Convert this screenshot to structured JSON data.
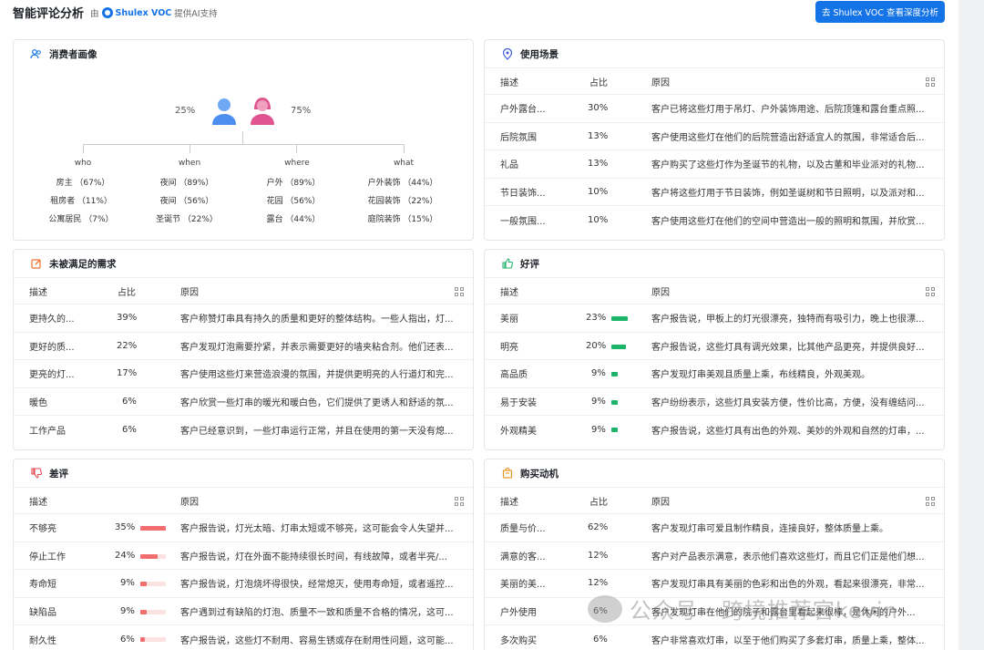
{
  "header": {
    "title": "智能评论分析",
    "by_prefix": "由",
    "brand": "Shulex VOC",
    "by_suffix": "提供AI支持",
    "cta": "去 Shulex VOC 查看深度分析"
  },
  "common": {
    "col_desc": "描述",
    "col_pct": "占比",
    "col_reason": "原因"
  },
  "persona": {
    "title": "消费者画像",
    "male_pct": "25%",
    "female_pct": "75%",
    "columns": [
      {
        "head": "who",
        "items": [
          "房主 （67%）",
          "租房者 （11%）",
          "公寓居民 （7%）"
        ]
      },
      {
        "head": "when",
        "items": [
          "夜间 （89%）",
          "夜间 （56%）",
          "圣诞节 （22%）"
        ]
      },
      {
        "head": "where",
        "items": [
          "户外 （89%）",
          "花园 （56%）",
          "露台 （44%）"
        ]
      },
      {
        "head": "what",
        "items": [
          "户外装饰 （44%）",
          "花园装饰 （22%）",
          "庭院装饰 （15%）"
        ]
      }
    ]
  },
  "scenes": {
    "title": "使用场景",
    "rows": [
      {
        "desc": "户外露台...",
        "pct": "30%",
        "reason": "客户已将这些灯用于吊灯、户外装饰用途、后院顶篷和露台重点照..."
      },
      {
        "desc": "后院氛围",
        "pct": "13%",
        "reason": "客户使用这些灯在他们的后院营造出舒适宜人的氛围，非常适合后..."
      },
      {
        "desc": "礼品",
        "pct": "13%",
        "reason": "客户购买了这些灯作为圣诞节的礼物，以及古董和毕业派对的礼物..."
      },
      {
        "desc": "节日装饰...",
        "pct": "10%",
        "reason": "客户将这些灯用于节日装饰，例如圣诞树和节日照明，以及派对和..."
      },
      {
        "desc": "一般氛围...",
        "pct": "10%",
        "reason": "客户使用这些灯在他们的空间中营造出一般的照明和氛围，并欣赏..."
      }
    ]
  },
  "unmet": {
    "title": "未被满足的需求",
    "rows": [
      {
        "desc": "更持久的...",
        "pct": "39%",
        "reason": "客户称赞灯串具有持久的质量和更好的整体结构。一些人指出，灯..."
      },
      {
        "desc": "更好的质...",
        "pct": "22%",
        "reason": "客户发现灯泡需要拧紧，并表示需要更好的墙夹粘合剂。他们还表..."
      },
      {
        "desc": "更亮的灯...",
        "pct": "17%",
        "reason": "客户使用这些灯来营造浪漫的氛围，并提供更明亮的人行道灯和完..."
      },
      {
        "desc": "暖色",
        "pct": "6%",
        "reason": "客户欣赏一些灯串的暖光和暖白色，它们提供了更诱人和舒适的氛..."
      },
      {
        "desc": "工作产品",
        "pct": "6%",
        "reason": "客户已经意识到，一些灯串运行正常，并且在使用的第一天没有熄..."
      }
    ]
  },
  "positive": {
    "title": "好评",
    "rows": [
      {
        "desc": "美丽",
        "pct": "23%",
        "value": 23,
        "reason": "客户报告说，甲板上的灯光很漂亮，独特而有吸引力，晚上也很漂..."
      },
      {
        "desc": "明亮",
        "pct": "20%",
        "value": 20,
        "reason": "客户报告说，这些灯具有调光效果，比其他产品更亮，并提供良好..."
      },
      {
        "desc": "高品质",
        "pct": "9%",
        "value": 9,
        "reason": "客户发现灯串美观且质量上乘，布线精良，外观美观。"
      },
      {
        "desc": "易于安装",
        "pct": "9%",
        "value": 9,
        "reason": "客户纷纷表示，这些灯具安装方便，性价比高，方便，没有缠结问..."
      },
      {
        "desc": "外观精美",
        "pct": "9%",
        "value": 9,
        "reason": "客户报告说，这些灯具有出色的外观、美妙的外观和自然的灯串，..."
      }
    ]
  },
  "negative": {
    "title": "差评",
    "rows": [
      {
        "desc": "不够亮",
        "pct": "35%",
        "value": 35,
        "reason": "客户报告说，灯光太暗、灯串太短或不够亮，这可能会令人失望并..."
      },
      {
        "desc": "停止工作",
        "pct": "24%",
        "value": 24,
        "reason": "客户报告说，灯在外面不能持续很长时间，有线故障，或者半亮/..."
      },
      {
        "desc": "寿命短",
        "pct": "9%",
        "value": 9,
        "reason": "客户报告说，灯泡烧坏得很快，经常熄灭，使用寿命短，或者遥控..."
      },
      {
        "desc": "缺陷品",
        "pct": "9%",
        "value": 9,
        "reason": "客户遇到过有缺陷的灯泡、质量不一致和质量不合格的情况，这可..."
      },
      {
        "desc": "耐久性",
        "pct": "6%",
        "value": 6,
        "reason": "客户报告说，这些灯不耐用、容易生锈或存在耐用性问题，这可能..."
      }
    ]
  },
  "motive": {
    "title": "购买动机",
    "rows": [
      {
        "desc": "质量与价...",
        "pct": "62%",
        "reason": "客户发现灯串可爱且制作精良，连接良好，整体质量上乘。"
      },
      {
        "desc": "满意的客...",
        "pct": "12%",
        "reason": "客户对产品表示满意，表示他们喜欢这些灯，而且它们正是他们想..."
      },
      {
        "desc": "美丽的美...",
        "pct": "12%",
        "reason": "客户发现灯串具有美丽的色彩和出色的外观，看起来很漂亮，非常..."
      },
      {
        "desc": "户外使用",
        "pct": "6%",
        "reason": "客户发现灯串在他们的院子和露台里看起来很棒，是休闲的户外..."
      },
      {
        "desc": "多次购买",
        "pct": "6%",
        "reason": "客户非常喜欢灯串，以至于他们购买了多套灯串，质量上乘，整体..."
      }
    ]
  },
  "watermark": "公众号 · 跨境推荐官kevin"
}
